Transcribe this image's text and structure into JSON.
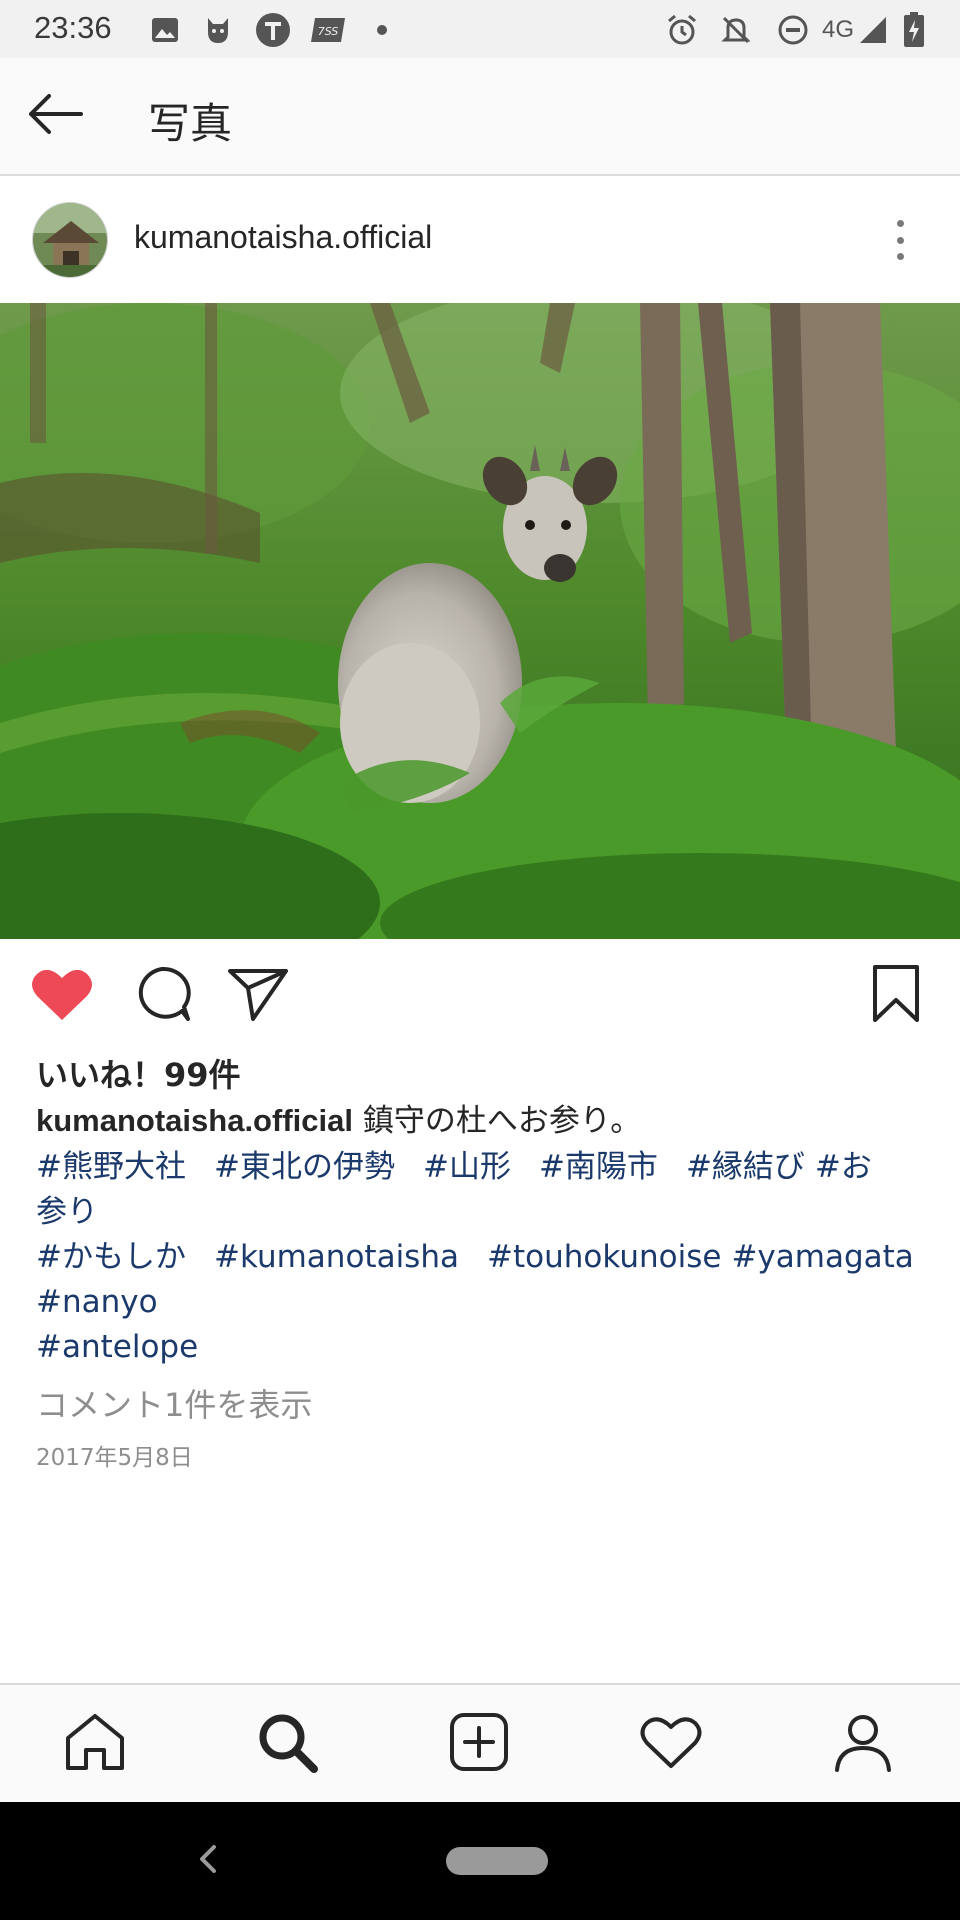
{
  "status_bar": {
    "time": "23:36",
    "network": "4G",
    "left_icons": [
      "image-icon",
      "cat-icon",
      "t-badge-icon",
      "tss-icon",
      "dot-icon"
    ],
    "right_icons": [
      "alarm-icon",
      "bell-off-icon",
      "dnd-icon",
      "signal-icon",
      "battery-icon"
    ]
  },
  "app_bar": {
    "title": "写真",
    "back_icon": "arrow-left-icon"
  },
  "post": {
    "username": "kumanotaisha.official",
    "likes": "いいね！99件",
    "caption_user": "kumanotaisha.official",
    "caption_text": " 鎮守の杜へお参り。",
    "tags_line1": [
      "#熊野大社",
      "#東北の伊勢",
      "#山形",
      "#南陽市",
      "#縁結び",
      "#お"
    ],
    "tags_line2": "参り",
    "tags_line3": [
      "#かもしか",
      "#kumanotaisha",
      "#touhokunoise",
      "#yamagata"
    ],
    "tags_line4": "#nanyo",
    "tags_line5": "#antelope",
    "view_comments": "コメント1件を表示",
    "date": "2017年5月8日",
    "liked": true
  },
  "colors": {
    "like_red": "#ed4956",
    "hashtag_blue": "#1b3a6b",
    "muted_gray": "#8e8e8e",
    "text_dark": "#262626"
  },
  "bottom_nav": [
    "home-icon",
    "search-icon",
    "add-post-icon",
    "activity-heart-icon",
    "profile-icon"
  ],
  "system_nav": [
    "back-icon",
    "home-pill"
  ]
}
